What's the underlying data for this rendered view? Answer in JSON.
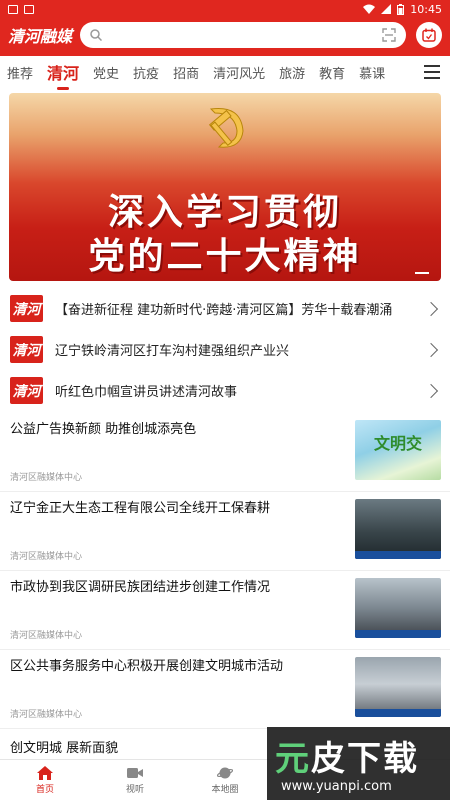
{
  "status": {
    "time": "10:45"
  },
  "header": {
    "logo": "清河融媒",
    "search_placeholder": "",
    "accent": "#e0271f"
  },
  "tabs": [
    "推荐",
    "清河",
    "党史",
    "抗疫",
    "招商",
    "清河风光",
    "旅游",
    "教育",
    "慕课"
  ],
  "active_tab": "清河",
  "banner": {
    "line1": "深入学习贯彻",
    "line2": "党的二十大精神"
  },
  "headlines": [
    {
      "badge": "清河",
      "text": "【奋进新征程 建功新时代·跨越·清河区篇】芳华十载春潮涌"
    },
    {
      "badge": "清河",
      "text": "辽宁铁岭清河区打车沟村建强组织产业兴"
    },
    {
      "badge": "清河",
      "text": "听红色巾帼宣讲员讲述清河故事"
    }
  ],
  "news": [
    {
      "title": "公益广告换新颜 助推创城添亮色",
      "source": "清河区融媒体中心",
      "thumb_word": "文明交"
    },
    {
      "title": "辽宁金正大生态工程有限公司全线开工保春耕",
      "source": "清河区融媒体中心"
    },
    {
      "title": "市政协到我区调研民族团结进步创建工作情况",
      "source": "清河区融媒体中心"
    },
    {
      "title": "区公共事务服务中心积极开展创建文明城市活动",
      "source": "清河区融媒体中心"
    }
  ],
  "last_title": "创文明城  展新面貌",
  "bottom_nav": [
    {
      "label": "首页",
      "icon": "home-icon"
    },
    {
      "label": "视听",
      "icon": "video-icon"
    },
    {
      "label": "本地圈",
      "icon": "planet-icon"
    },
    {
      "label": "",
      "icon": ""
    },
    {
      "label": "",
      "icon": ""
    }
  ],
  "watermark": {
    "big_green": "元",
    "big_white": "皮下载",
    "url": "www.yuanpi.com"
  }
}
